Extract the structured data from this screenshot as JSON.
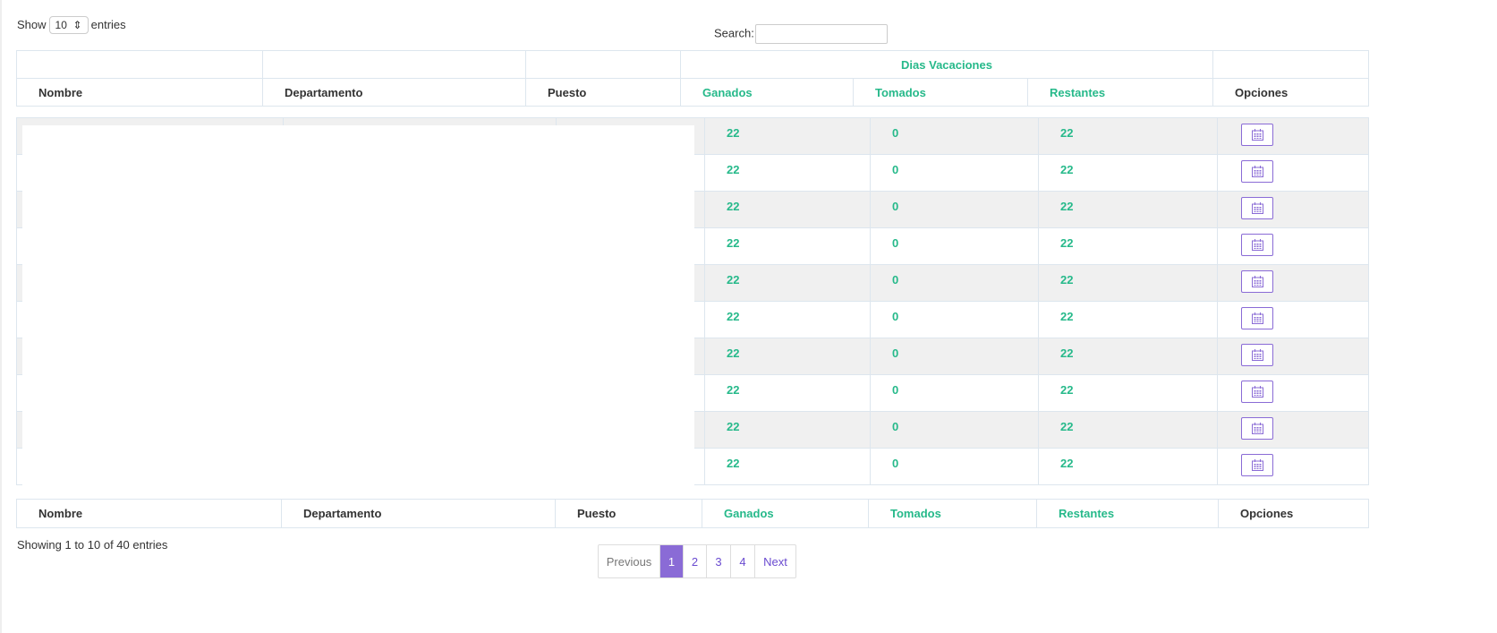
{
  "length_control": {
    "show": "Show",
    "value": "10",
    "entries": "entries"
  },
  "search": {
    "label": "Search:",
    "value": ""
  },
  "header": {
    "group": "Dias Vacaciones",
    "columns": [
      "Nombre",
      "Departamento",
      "Puesto",
      "Ganados",
      "Tomados",
      "Restantes",
      "Opciones"
    ]
  },
  "rows": [
    {
      "ganados": "22",
      "tomados": "0",
      "restantes": "22"
    },
    {
      "ganados": "22",
      "tomados": "0",
      "restantes": "22"
    },
    {
      "ganados": "22",
      "tomados": "0",
      "restantes": "22"
    },
    {
      "ganados": "22",
      "tomados": "0",
      "restantes": "22"
    },
    {
      "ganados": "22",
      "tomados": "0",
      "restantes": "22"
    },
    {
      "ganados": "22",
      "tomados": "0",
      "restantes": "22"
    },
    {
      "ganados": "22",
      "tomados": "0",
      "restantes": "22"
    },
    {
      "ganados": "22",
      "tomados": "0",
      "restantes": "22"
    },
    {
      "ganados": "22",
      "tomados": "0",
      "restantes": "22"
    },
    {
      "ganados": "22",
      "tomados": "0",
      "restantes": "22"
    }
  ],
  "row_action_icon": "calendar-icon",
  "info": "Showing 1 to 10 of 40 entries",
  "pagination": {
    "previous": "Previous",
    "pages": [
      "1",
      "2",
      "3",
      "4"
    ],
    "active": "1",
    "next": "Next"
  },
  "colors": {
    "accent_green": "#26b98a",
    "accent_purple": "#8a6bd6",
    "stripe": "#f0f0f0"
  }
}
